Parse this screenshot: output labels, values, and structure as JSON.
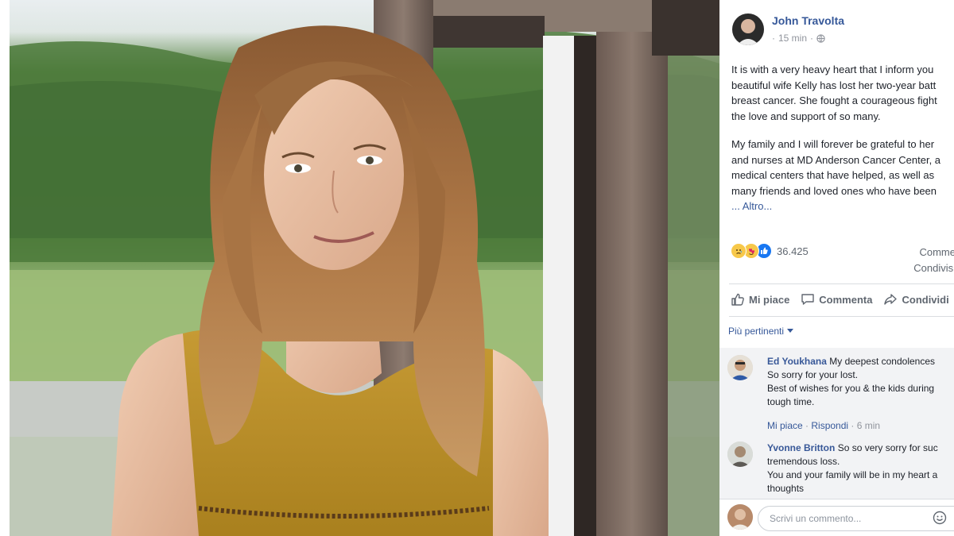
{
  "post": {
    "author": "John Travolta",
    "time": "15 min",
    "privacy_icon": "globe-icon",
    "paragraph1": [
      "It is with a very heavy heart that I inform you",
      "beautiful wife Kelly has lost her two-year batt",
      "breast cancer. She fought a courageous fight",
      "the love and support of so many."
    ],
    "paragraph2": [
      "My family and I will forever be grateful to her",
      "and nurses at MD Anderson Cancer Center, a",
      "medical centers that have helped, as well as",
      "many friends and loved ones who have been"
    ],
    "more": "... Altro...",
    "reaction_count": "36.425",
    "reaction_icons": [
      "sad-icon",
      "love-icon",
      "like-icon"
    ],
    "comments_count_label": "Comme",
    "shares_count_label": "Condivisi"
  },
  "actions": {
    "like": "Mi piace",
    "comment": "Commenta",
    "share": "Condividi"
  },
  "comments_filter": "Più pertinenti",
  "comments": [
    {
      "author": "Ed Youkhana",
      "lines": [
        "My deepest condolences",
        "So sorry for your lost.",
        "Best of wishes for you & the kids during",
        "tough time."
      ],
      "like": "Mi piace",
      "reply": "Rispondi",
      "time": "6 min"
    },
    {
      "author": "Yvonne Britton",
      "lines": [
        "So so very sorry for suc",
        "tremendous loss.",
        "You and your family will be in my heart a",
        "thoughts"
      ]
    }
  ],
  "composer": {
    "placeholder": "Scrivi un commento..."
  },
  "colors": {
    "link": "#365899",
    "muted": "#606770",
    "comments_bg": "#f2f3f5",
    "like_blue": "#1877f2"
  }
}
